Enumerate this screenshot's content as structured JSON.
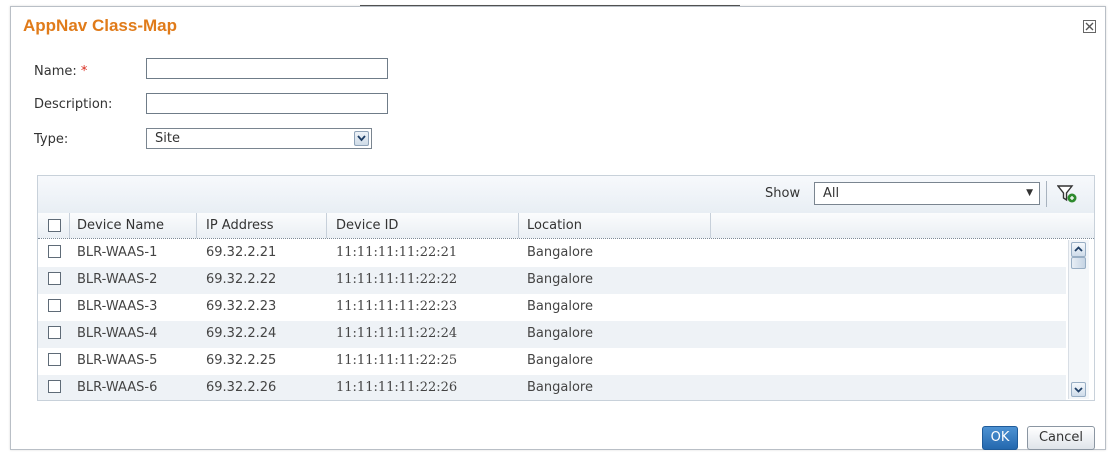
{
  "dialog": {
    "title": "AppNav Class-Map",
    "close_icon": "close-icon"
  },
  "form": {
    "name_label": "Name:",
    "name_required": "*",
    "name_value": "",
    "description_label": "Description:",
    "description_value": "",
    "type_label": "Type:",
    "type_value": "Site"
  },
  "grid": {
    "show_label": "Show",
    "show_value": "All",
    "filter_icon": "filter-icon",
    "columns": [
      "Device Name",
      "IP Address",
      "Device ID",
      "Location"
    ],
    "rows": [
      {
        "device_name": "BLR-WAAS-1",
        "ip_address": "69.32.2.21",
        "device_id": "11:11:11:11:22:21",
        "location": "Bangalore"
      },
      {
        "device_name": "BLR-WAAS-2",
        "ip_address": "69.32.2.22",
        "device_id": "11:11:11:11:22:22",
        "location": "Bangalore"
      },
      {
        "device_name": "BLR-WAAS-3",
        "ip_address": "69.32.2.23",
        "device_id": "11:11:11:11:22:23",
        "location": "Bangalore"
      },
      {
        "device_name": "BLR-WAAS-4",
        "ip_address": "69.32.2.24",
        "device_id": "11:11:11:11:22:24",
        "location": "Bangalore"
      },
      {
        "device_name": "BLR-WAAS-5",
        "ip_address": "69.32.2.25",
        "device_id": "11:11:11:11:22:25",
        "location": "Bangalore"
      },
      {
        "device_name": "BLR-WAAS-6",
        "ip_address": "69.32.2.26",
        "device_id": "11:11:11:11:22:26",
        "location": "Bangalore"
      }
    ]
  },
  "buttons": {
    "ok": "OK",
    "cancel": "Cancel"
  },
  "colors": {
    "title": "#e07b1a",
    "primary_button": "#2f74bd",
    "required": "#d9291c"
  }
}
